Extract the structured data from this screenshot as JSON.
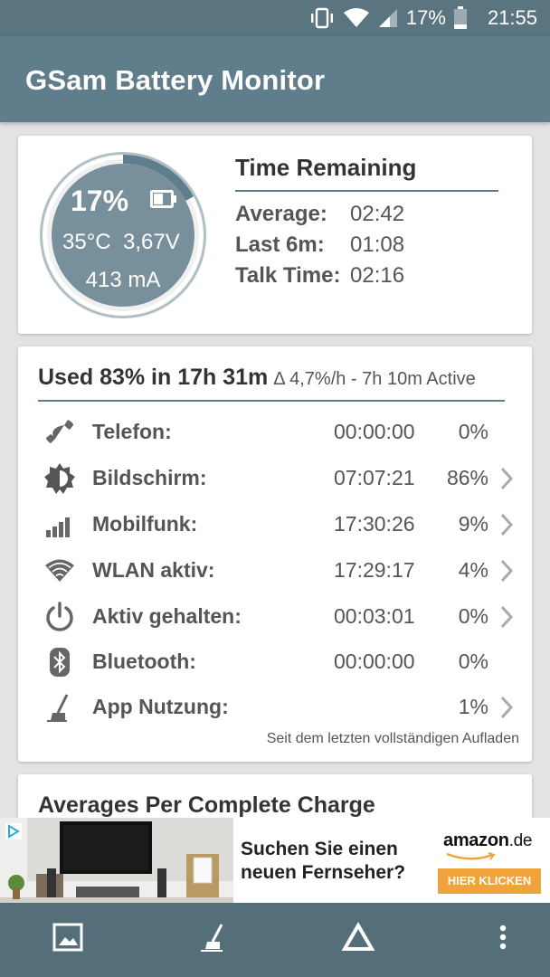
{
  "status_bar": {
    "battery_percent": "17%",
    "clock": "21:55",
    "icons": [
      "vibrate-icon",
      "wifi-icon",
      "signal-icon",
      "battery-icon"
    ]
  },
  "app_bar": {
    "title": "GSam Battery Monitor"
  },
  "summary": {
    "gauge": {
      "percent": "17%",
      "temperature": "35°C",
      "voltage": "3,67V",
      "current": "413 mA",
      "level_fraction": 0.17
    },
    "time_remaining": {
      "title": "Time Remaining",
      "rows": [
        {
          "label": "Average:",
          "value": "02:42"
        },
        {
          "label": "Last 6m:",
          "value": "01:08"
        },
        {
          "label": "Talk Time:",
          "value": "02:16"
        }
      ]
    }
  },
  "usage": {
    "headline": "Used 83% in 17h 31m",
    "subline": "Δ 4,7%/h - 7h 10m Active",
    "rows": [
      {
        "icon": "phone-icon",
        "name": "Telefon:",
        "time": "00:00:00",
        "percent": "0%",
        "has_chevron": false
      },
      {
        "icon": "screen-brightness-icon",
        "name": "Bildschirm:",
        "time": "07:07:21",
        "percent": "86%",
        "has_chevron": true
      },
      {
        "icon": "cell-signal-icon",
        "name": "Mobilfunk:",
        "time": "17:30:26",
        "percent": "9%",
        "has_chevron": true
      },
      {
        "icon": "wifi-icon",
        "name": "WLAN aktiv:",
        "time": "17:29:17",
        "percent": "4%",
        "has_chevron": true
      },
      {
        "icon": "power-icon",
        "name": "Aktiv gehalten:",
        "time": "00:03:01",
        "percent": "0%",
        "has_chevron": true
      },
      {
        "icon": "bluetooth-icon",
        "name": "Bluetooth:",
        "time": "00:00:00",
        "percent": "0%",
        "has_chevron": false
      },
      {
        "icon": "app-usage-icon",
        "name": "App Nutzung:",
        "time": "",
        "percent": "1%",
        "has_chevron": true
      }
    ],
    "footnote": "Seit dem letzten vollständigen Aufladen"
  },
  "averages": {
    "title": "Averages Per Complete Charge"
  },
  "ad": {
    "text_line1": "Suchen Sie einen",
    "text_line2": "neuen Fernseher?",
    "brand": "amazon",
    "brand_tld": ".de",
    "cta": "HIER KLICKEN"
  },
  "bottom_bar": {
    "items": [
      "image-icon",
      "app-usage-icon",
      "delta-icon",
      "more-vert-icon"
    ]
  },
  "colors": {
    "primary": "#607d8b",
    "status_bar": "#5a7480",
    "bottom_bar": "#546e7a",
    "background": "#e3e3e3",
    "gauge_fill": "#78909c",
    "ad_button": "#f0a33a"
  }
}
